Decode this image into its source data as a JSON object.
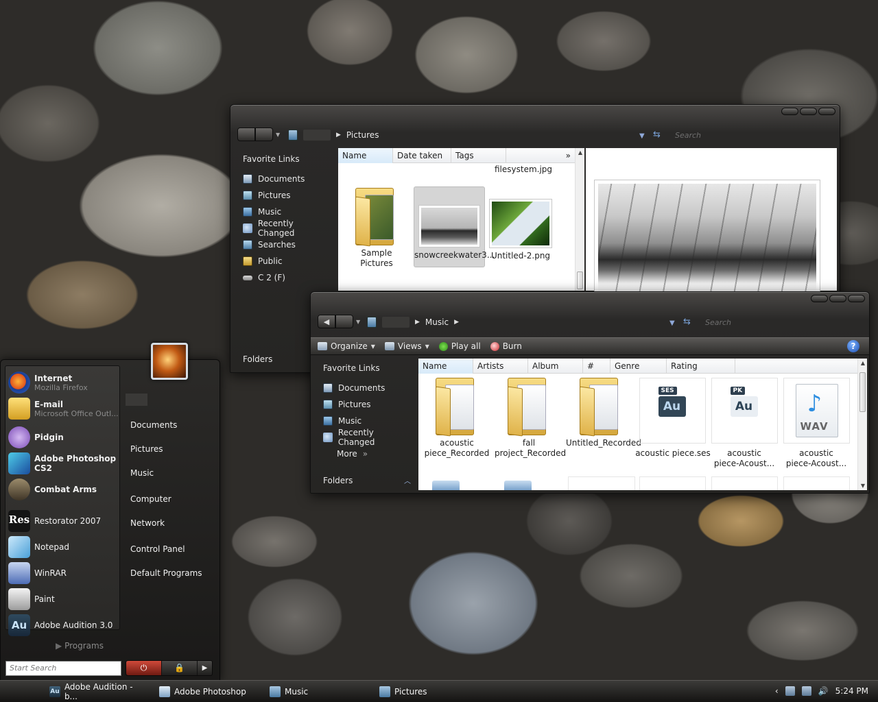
{
  "pictures_window": {
    "address": {
      "current": "Pictures"
    },
    "search_placeholder": "Search",
    "sidebar": {
      "heading": "Favorite Links",
      "items": [
        {
          "label": "Documents",
          "icon": "documents-icon"
        },
        {
          "label": "Pictures",
          "icon": "pictures-icon"
        },
        {
          "label": "Music",
          "icon": "music-icon"
        },
        {
          "label": "Recently Changed",
          "icon": "recently-changed-icon"
        },
        {
          "label": "Searches",
          "icon": "searches-icon"
        },
        {
          "label": "Public",
          "icon": "public-folder-icon"
        },
        {
          "label": "C 2 (F)",
          "icon": "drive-icon"
        }
      ],
      "footer": "Folders"
    },
    "columns": [
      "Name",
      "Date taken",
      "Tags"
    ],
    "columns_more": "»",
    "top_partial_file": "filesystem.jpg",
    "files": [
      {
        "name": "Sample Pictures",
        "kind": "folder-shortcut"
      },
      {
        "name": "snowcreekwater3...",
        "kind": "image",
        "selected": true
      },
      {
        "name": "Untitled-2.png",
        "kind": "image"
      }
    ]
  },
  "music_window": {
    "address": {
      "current": "Music"
    },
    "search_placeholder": "Search",
    "toolbar": {
      "organize": "Organize",
      "views": "Views",
      "play_all": "Play all",
      "burn": "Burn",
      "help": "?"
    },
    "sidebar": {
      "heading": "Favorite Links",
      "items": [
        {
          "label": "Documents",
          "icon": "documents-icon"
        },
        {
          "label": "Pictures",
          "icon": "pictures-icon"
        },
        {
          "label": "Music",
          "icon": "music-icon"
        },
        {
          "label": "Recently Changed",
          "icon": "recently-changed-icon"
        }
      ],
      "more": "More",
      "more_chevron": "»",
      "footer": "Folders"
    },
    "columns": [
      "Name",
      "Artists",
      "Album",
      "#",
      "Genre",
      "Rating"
    ],
    "files": [
      {
        "line1": "acoustic",
        "line2": "piece_Recorded",
        "kind": "folder"
      },
      {
        "line1": "fall",
        "line2": "project_Recorded",
        "kind": "folder"
      },
      {
        "line1": "Untitled_Recorded",
        "line2": "",
        "kind": "folder"
      },
      {
        "line1": "acoustic piece.ses",
        "line2": "",
        "kind": "ses",
        "badge": "SES",
        "big": "Au"
      },
      {
        "line1": "acoustic",
        "line2": "piece-Acoust...",
        "kind": "pk",
        "badge": "PK",
        "big": "Au"
      },
      {
        "line1": "acoustic",
        "line2": "piece-Acoust...",
        "kind": "wav",
        "wav": "WAV",
        "note": "♪"
      }
    ]
  },
  "start_menu": {
    "pinned": [
      {
        "name": "Internet",
        "sub": "Mozilla Firefox",
        "bold": true,
        "icon": "firefox-icon"
      },
      {
        "name": "E-mail",
        "sub": "Microsoft Office Outl...",
        "bold": true,
        "icon": "email-icon"
      },
      {
        "name": "Pidgin",
        "sub": "",
        "bold": true,
        "icon": "pidgin-icon"
      },
      {
        "name": "Adobe Photoshop CS2",
        "sub": "",
        "bold": true,
        "icon": "photoshop-icon"
      },
      {
        "name": "Combat Arms",
        "sub": "",
        "bold": true,
        "icon": "combat-arms-icon"
      }
    ],
    "recent": [
      {
        "name": "Restorator 2007",
        "icon": "restorator-icon",
        "glyph": "Res"
      },
      {
        "name": "Notepad",
        "icon": "notepad-icon"
      },
      {
        "name": "WinRAR",
        "icon": "winrar-icon"
      },
      {
        "name": "Paint",
        "icon": "paint-icon"
      },
      {
        "name": "Adobe Audition 3.0",
        "icon": "audition-icon",
        "glyph": "Au"
      }
    ],
    "all_programs": "Programs",
    "search_placeholder": "Start Search",
    "right_links": [
      "Documents",
      "Pictures",
      "Music",
      "Computer",
      "Network",
      "Control Panel",
      "Default Programs"
    ]
  },
  "taskbar": {
    "items": [
      {
        "label": "Adobe Audition - b...",
        "icon": "audition-icon"
      },
      {
        "label": "Adobe Photoshop",
        "icon": "photoshop-icon"
      },
      {
        "label": "Music",
        "icon": "music-folder-icon"
      },
      {
        "label": "Pictures",
        "icon": "pictures-folder-icon"
      }
    ],
    "clock": "5:24 PM"
  }
}
